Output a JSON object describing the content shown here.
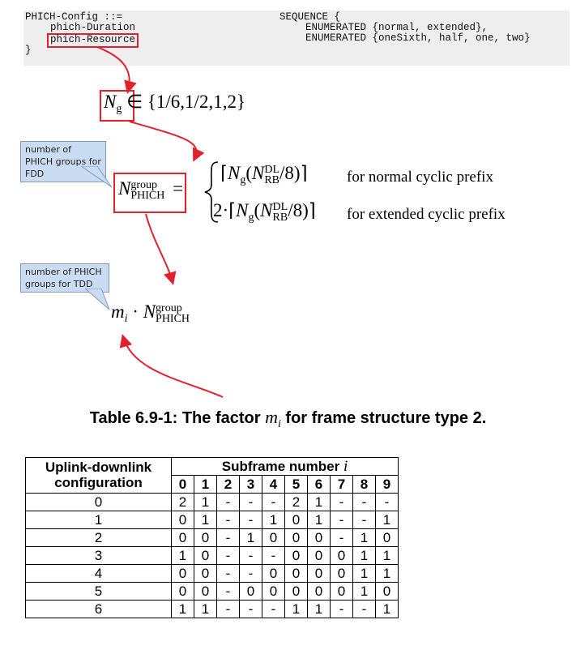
{
  "code": {
    "line1_left": "PHICH-Config ::=",
    "line1_right": "SEQUENCE {",
    "duration_name": "phich-Duration",
    "duration_type": "ENUMERATED {normal, extended},",
    "resource_name": "phich-Resource",
    "resource_type": "ENUMERATED {oneSixth, half, one, two}",
    "close": "}"
  },
  "formula1": {
    "symbol": "N",
    "subscript": "g",
    "rest": "∈ {1/6,1/2,1,2}"
  },
  "callouts": {
    "fdd": "number of PHICH groups for FDD",
    "tdd": "number of PHICH groups for TDD"
  },
  "formula2": {
    "symbol": "N",
    "sup": "group",
    "sub": "PHICH",
    "normal_expr_N": "N",
    "normal_expr_g": "g",
    "rb_sup": "DL",
    "rb_sub": "RB",
    "div8": "/8",
    "extended_coeff": "2·",
    "normal_label": "for normal cyclic prefix",
    "extended_label": "for extended cyclic prefix"
  },
  "formula3": {
    "m": "m",
    "i": "i",
    "dot": "·",
    "N": "N",
    "sup": "group",
    "sub": "PHICH"
  },
  "caption": {
    "prefix": "Table 6.9-1: The factor",
    "m": "m",
    "i": "i",
    "suffix": "for frame structure type 2."
  },
  "table": {
    "config_header": "Uplink-downlink configuration",
    "subframe_header": "Subframe number",
    "subframe_symbol": "i",
    "subframe_numbers": [
      "0",
      "1",
      "2",
      "3",
      "4",
      "5",
      "6",
      "7",
      "8",
      "9"
    ],
    "rows": [
      {
        "config": "0",
        "values": [
          "2",
          "1",
          "-",
          "-",
          "-",
          "2",
          "1",
          "-",
          "-",
          "-"
        ]
      },
      {
        "config": "1",
        "values": [
          "0",
          "1",
          "-",
          "-",
          "1",
          "0",
          "1",
          "-",
          "-",
          "1"
        ]
      },
      {
        "config": "2",
        "values": [
          "0",
          "0",
          "-",
          "1",
          "0",
          "0",
          "0",
          "-",
          "1",
          "0"
        ]
      },
      {
        "config": "3",
        "values": [
          "1",
          "0",
          "-",
          "-",
          "-",
          "0",
          "0",
          "0",
          "1",
          "1"
        ]
      },
      {
        "config": "4",
        "values": [
          "0",
          "0",
          "-",
          "-",
          "0",
          "0",
          "0",
          "0",
          "1",
          "1"
        ]
      },
      {
        "config": "5",
        "values": [
          "0",
          "0",
          "-",
          "0",
          "0",
          "0",
          "0",
          "0",
          "1",
          "0"
        ]
      },
      {
        "config": "6",
        "values": [
          "1",
          "1",
          "-",
          "-",
          "-",
          "1",
          "1",
          "-",
          "-",
          "1"
        ]
      }
    ]
  },
  "colors": {
    "highlight": "#e0222e",
    "callout_fill": "#c9dcf2",
    "code_background": "#eeeeee"
  }
}
